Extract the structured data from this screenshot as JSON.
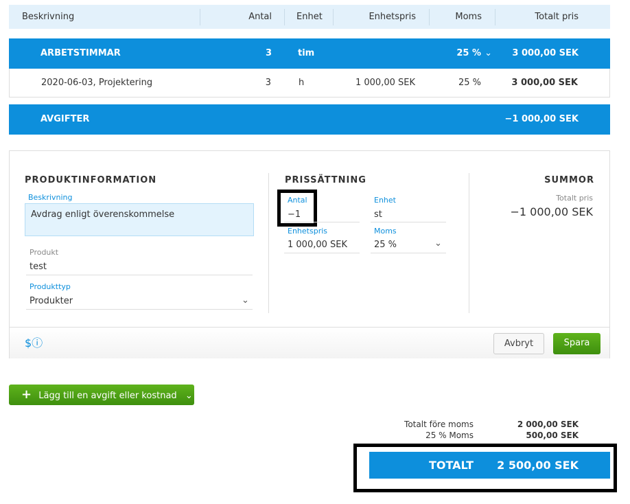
{
  "table": {
    "headers": [
      "Beskrivning",
      "Antal",
      "Enhet",
      "Enhetspris",
      "Moms",
      "Totalt pris"
    ]
  },
  "groups": [
    {
      "name": "ARBETSTIMMAR",
      "qty": "3",
      "unit": "tim",
      "vat": "25 %",
      "total": "3 000,00 SEK"
    },
    {
      "name": "AVGIFTER",
      "total": "−1 000,00 SEK"
    }
  ],
  "rows": [
    {
      "desc": "2020-06-03, Projektering",
      "qty": "3",
      "unit": "h",
      "price": "1 000,00 SEK",
      "vat": "25 %",
      "total": "3 000,00 SEK"
    }
  ],
  "editor": {
    "product_section": "PRODUKTINFORMATION",
    "desc_label": "Beskrivning",
    "desc_value": "Avdrag enligt överenskommelse",
    "product_label": "Produkt",
    "product_value": "test",
    "type_label": "Produkttyp",
    "type_value": "Produkter",
    "pricing_section": "PRISSÄTTNING",
    "qty_label": "Antal",
    "qty_value": "−1",
    "unit_label": "Enhet",
    "unit_value": "st",
    "price_label": "Enhetspris",
    "price_value": "1 000,00 SEK",
    "vat_label": "Moms",
    "vat_value": "25 %",
    "sums_section": "SUMMOR",
    "total_label": "Totalt pris",
    "total_value": "−1 000,00 SEK",
    "cancel": "Avbryt",
    "save": "Spara"
  },
  "add_button": "Lägg till en avgift eller kostnad",
  "summary": {
    "before_vat_label": "Totalt före moms",
    "before_vat": "2 000,00 SEK",
    "vat_label": "25 % Moms",
    "vat": "500,00 SEK",
    "total_label": "TOTALT",
    "total": "2 500,00 SEK"
  }
}
